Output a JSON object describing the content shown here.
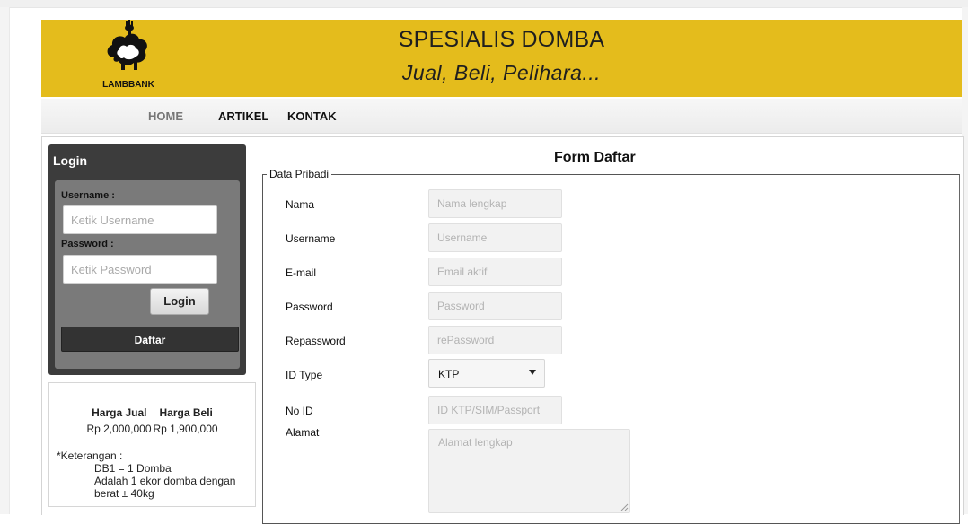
{
  "header": {
    "logo_text": "LAMBBANK",
    "title": "SPESIALIS DOMBA",
    "subtitle": "Jual, Beli, Pelihara...",
    "bg_color": "#e4bc1c"
  },
  "nav": {
    "items": [
      "HOME",
      "ARTIKEL",
      "KONTAK"
    ],
    "active": "HOME"
  },
  "login": {
    "title": "Login",
    "username_label": "Username :",
    "username_placeholder": "Ketik Username",
    "password_label": "Password :",
    "password_placeholder": "Ketik Password",
    "login_button": "Login",
    "register_button": "Daftar"
  },
  "price": {
    "sell_header": "Harga Jual",
    "buy_header": "Harga Beli",
    "sell_value": "Rp 2,000,000",
    "buy_value": "Rp 1,900,000",
    "note_label": "*Keterangan :",
    "note_lines": [
      "DB1 = 1 Domba",
      "Adalah 1 ekor domba dengan",
      "berat ± 40kg"
    ]
  },
  "form": {
    "title": "Form Daftar",
    "legend": "Data Pribadi",
    "fields": [
      {
        "label": "Nama",
        "placeholder": "Nama lengkap"
      },
      {
        "label": "Username",
        "placeholder": "Username"
      },
      {
        "label": "E-mail",
        "placeholder": "Email aktif"
      },
      {
        "label": "Password",
        "placeholder": "Password"
      },
      {
        "label": "Repassword",
        "placeholder": "rePassword"
      },
      {
        "label": "ID Type",
        "value": "KTP"
      },
      {
        "label": "No ID",
        "placeholder": "ID KTP/SIM/Passport"
      },
      {
        "label": "Alamat",
        "placeholder": "Alamat lengkap"
      }
    ]
  },
  "icons": {
    "logo": "sheep-icon",
    "select": "chevron-down-icon",
    "resize": "resize-grip-icon"
  }
}
